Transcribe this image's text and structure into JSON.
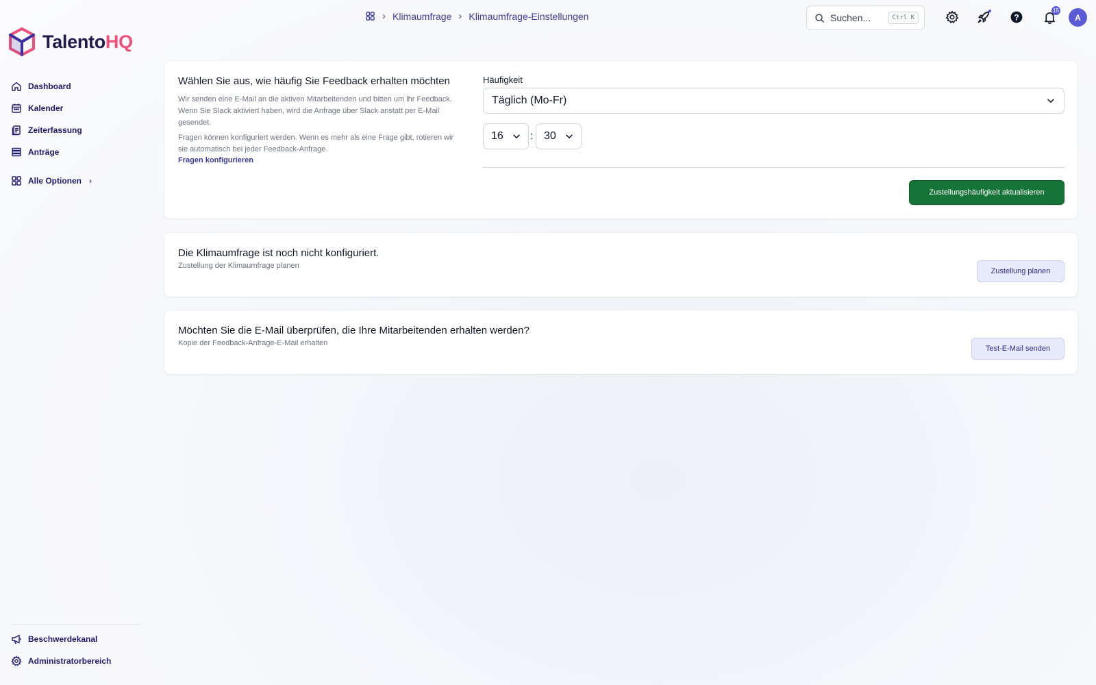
{
  "brand": {
    "name_part1": "Talento",
    "name_part2": "HQ",
    "accent": "#ec4f7a",
    "navy": "#1e1b4b"
  },
  "sidebar": {
    "items": [
      {
        "label": "Dashboard",
        "icon": "home-icon"
      },
      {
        "label": "Kalender",
        "icon": "calendar-icon"
      },
      {
        "label": "Zeiterfassung",
        "icon": "clipboard-icon"
      },
      {
        "label": "Anträge",
        "icon": "stack-icon"
      },
      {
        "label": "Alle Optionen",
        "icon": "grid-icon"
      }
    ],
    "bottom": [
      {
        "label": "Beschwerdekanal",
        "icon": "megaphone-icon"
      },
      {
        "label": "Administratorbereich",
        "icon": "gear-icon"
      }
    ]
  },
  "header": {
    "breadcrumb": [
      "Klimaumfrage",
      "Klimaumfrage-Einstellungen"
    ],
    "search": {
      "placeholder": "Suchen...",
      "shortcut": "Ctrl K"
    },
    "notifications_count": "15",
    "avatar_initial": "A"
  },
  "frequency_card": {
    "title": "Wählen Sie aus, wie häufig Sie Feedback erhalten möchten",
    "description1": "Wir senden eine E-Mail an die aktiven Mitarbeitenden und bitten um ihr Feedback. Wenn Sie Slack aktiviert haben, wird die Anfrage über Slack anstatt per E-Mail gesendet.",
    "description2": "Fragen können konfiguriert werden. Wenn es mehr als eine Frage gibt, rotieren wir sie automatisch bei jeder Feedback-Anfrage.",
    "link": "Fragen konfigurieren",
    "field_label": "Häufigkeit",
    "frequency_value": "Täglich (Mo-Fr)",
    "hour": "16",
    "minute": "30",
    "time_separator": ":",
    "update_button": "Zustellungshäufigkeit aktualisieren",
    "button_color": "#177438"
  },
  "schedule_card": {
    "title": "Die Klimaumfrage ist noch nicht konfiguriert.",
    "subtitle": "Zustellung der Klimaumfrage planen",
    "button": "Zustellung planen"
  },
  "test_email_card": {
    "title": "Möchten Sie die E-Mail überprüfen, die Ihre Mitarbeitenden erhalten werden?",
    "subtitle": "Kopie der Feedback-Anfrage-E-Mail erhalten",
    "button": "Test-E-Mail senden"
  }
}
